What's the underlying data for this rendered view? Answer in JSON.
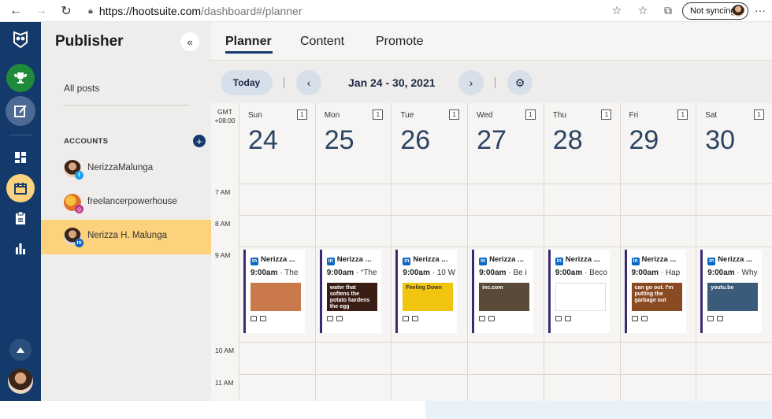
{
  "browser": {
    "url_host": "https://hootsuite.com",
    "url_path": "/dashboard#/planner",
    "sync_label": "Not syncing"
  },
  "publisher": {
    "title": "Publisher",
    "all_posts": "All posts",
    "accounts_heading": "ACCOUNTS",
    "accounts": [
      {
        "name": "NerizzaMalunga",
        "network": "twitter",
        "selected": false
      },
      {
        "name": "freelancerpowerhouse",
        "network": "instagram",
        "selected": false
      },
      {
        "name": "Nerizza H. Malunga",
        "network": "linkedin",
        "selected": true
      }
    ]
  },
  "tabs": [
    "Planner",
    "Content",
    "Promote"
  ],
  "toolbar": {
    "today_label": "Today",
    "date_range": "Jan 24 - 30, 2021"
  },
  "calendar": {
    "timezone_line1": "GMT",
    "timezone_line2": "+08:00",
    "hours": [
      "7 AM",
      "8 AM",
      "9 AM",
      "10 AM",
      "11 AM"
    ],
    "days": [
      {
        "name": "Sun",
        "num": "24",
        "count": "1"
      },
      {
        "name": "Mon",
        "num": "25",
        "count": "1"
      },
      {
        "name": "Tue",
        "num": "26",
        "count": "1"
      },
      {
        "name": "Wed",
        "num": "27",
        "count": "1"
      },
      {
        "name": "Thu",
        "num": "28",
        "count": "1"
      },
      {
        "name": "Fri",
        "num": "29",
        "count": "1"
      },
      {
        "name": "Sat",
        "num": "30",
        "count": "1"
      }
    ],
    "posts": [
      {
        "author": "Nerizza ...",
        "time": "9:00am",
        "snippet": " · The",
        "thumb_text": "",
        "thumb_color": "#c9794a"
      },
      {
        "author": "Nerizza ...",
        "time": "9:00am",
        "snippet": " · “The",
        "thumb_text": "water that softens the potato hardens the egg",
        "thumb_color": "#3a1d14"
      },
      {
        "author": "Nerizza ...",
        "time": "9:00am",
        "snippet": " · 10 W",
        "thumb_text": "Feeling Down",
        "thumb_color": "#f1c40f"
      },
      {
        "author": "Nerizza ...",
        "time": "9:00am",
        "snippet": " · Be i",
        "thumb_text": "inc.com",
        "thumb_color": "#5a4a3a"
      },
      {
        "author": "Nerizza ...",
        "time": "9:00am",
        "snippet": " · Beco",
        "thumb_text": "",
        "thumb_color": "#ffffff"
      },
      {
        "author": "Nerizza ...",
        "time": "9:00am",
        "snippet": " · Hap",
        "thumb_text": "can go out. I'm putting the garbage out",
        "thumb_color": "#8a4a22"
      },
      {
        "author": "Nerizza ...",
        "time": "9:00am",
        "snippet": " · Why",
        "thumb_text": "youtu.be",
        "thumb_color": "#3b5b7a"
      }
    ]
  }
}
